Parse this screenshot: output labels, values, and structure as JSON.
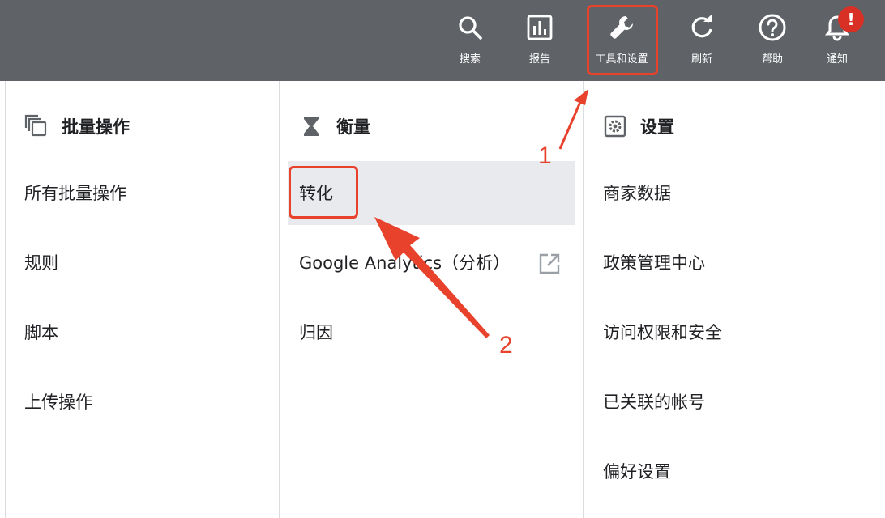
{
  "toolbar": {
    "buttons": [
      {
        "label": "搜索",
        "icon": "search-icon"
      },
      {
        "label": "报告",
        "icon": "bar-chart-icon"
      },
      {
        "label": "工具和设置",
        "icon": "wrench-icon"
      },
      {
        "label": "刷新",
        "icon": "refresh-icon"
      },
      {
        "label": "帮助",
        "icon": "help-icon"
      },
      {
        "label": "通知",
        "icon": "bell-icon"
      }
    ],
    "notification_badge": "!"
  },
  "menu": {
    "bulk": {
      "title": "批量操作",
      "icon": "copy-icon",
      "items": [
        "所有批量操作",
        "规则",
        "脚本",
        "上传操作"
      ]
    },
    "measure": {
      "title": "衡量",
      "icon": "hourglass-icon",
      "items": [
        "转化",
        "Google Analytics（分析）",
        "归因"
      ]
    },
    "settings": {
      "title": "设置",
      "icon": "gear-icon",
      "items": [
        "商家数据",
        "政策管理中心",
        "访问权限和安全",
        "已关联的帐号",
        "偏好设置"
      ]
    }
  },
  "annotations": {
    "step1": "1",
    "step2": "2"
  },
  "colors": {
    "topbar": "#5f6368",
    "highlight": "#e8eaed",
    "annotation": "#e8412c"
  }
}
